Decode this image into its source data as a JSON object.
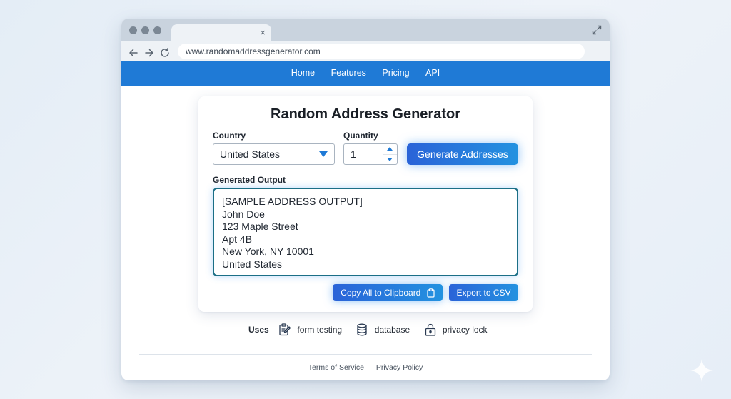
{
  "browser": {
    "url": "www.randomaddressgenerator.com",
    "tab_close_glyph": "×"
  },
  "site_nav": [
    "Home",
    "Features",
    "Pricing",
    "API"
  ],
  "card": {
    "title": "Random Address Generator",
    "country_label": "Country",
    "country_value": "United States",
    "quantity_label": "Quantity",
    "quantity_value": "1",
    "generate_button": "Generate Addresses",
    "output_label": "Generated Output",
    "output_lines": [
      "[SAMPLE ADDRESS OUTPUT]",
      "John Doe",
      "123 Maple Street",
      "Apt 4B",
      "New York, NY 10001",
      "United States"
    ],
    "copy_button": "Copy All to Clipboard",
    "csv_button": "Export to CSV"
  },
  "uses": {
    "label": "Uses",
    "items": [
      {
        "icon": "clipboard-edit-icon",
        "text": "form testing"
      },
      {
        "icon": "database-icon",
        "text": "database"
      },
      {
        "icon": "lock-icon",
        "text": "privacy lock"
      }
    ]
  },
  "footer": [
    "Terms of Service",
    "Privacy Policy"
  ],
  "colors": {
    "nav_bar": "#1f7ad6",
    "button_start": "#2a63d8",
    "button_end": "#2392e0",
    "output_border": "#1b6f86"
  }
}
